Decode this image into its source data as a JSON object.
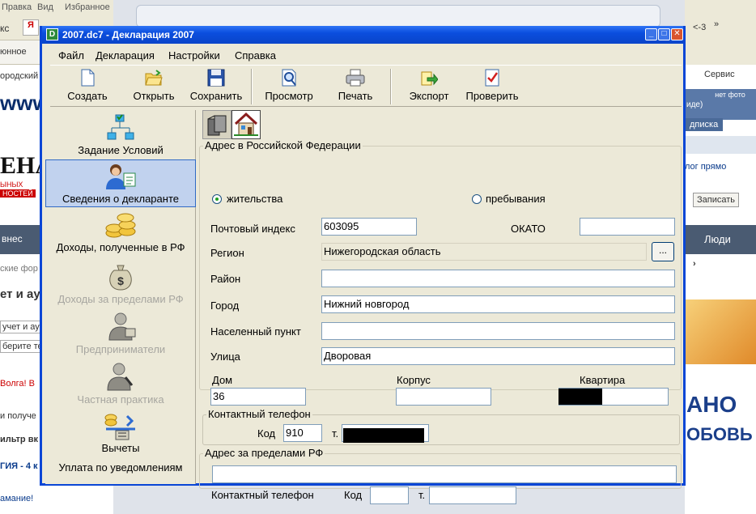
{
  "browser": {
    "menu": [
      "Правка",
      "Вид",
      "Избранное"
    ],
    "address_fragment": "кс",
    "links_fragment": "юнное",
    "left_texts": [
      "ородский",
      "ЕНАР",
      "ЫНЫХ",
      "НОСТЕЙ",
      "внес",
      "ские фор",
      "ет и ау",
      "учет и ау",
      "берите те",
      "Волга! В",
      "и получе",
      "ильтр вк",
      "ГИЯ - 4 к",
      "амание!"
    ],
    "right_texts": [
      "<-3",
      "»",
      "Сервис",
      "дписка",
      "Люди",
      "лог прямо",
      "Записать",
      "АНО",
      "ОБОВЬ",
      "нет фото",
      "иде)"
    ]
  },
  "window": {
    "title": "2007.dc7 - Декларация 2007",
    "menu": [
      "Файл",
      "Декларация",
      "Настройки",
      "Справка"
    ]
  },
  "toolbar": {
    "create": "Создать",
    "open": "Открыть",
    "save": "Сохранить",
    "preview": "Просмотр",
    "print": "Печать",
    "export": "Экспорт",
    "check": "Проверить"
  },
  "sidebar": {
    "items": [
      {
        "label": "Задание Условий",
        "icon": "conditions-icon"
      },
      {
        "label": "Сведения о декларанте",
        "icon": "declarant-icon"
      },
      {
        "label": "Доходы, полученные в РФ",
        "icon": "coins-icon"
      },
      {
        "label": "Доходы за пределами РФ",
        "icon": "money-bag-icon"
      },
      {
        "label": "Предприниматели",
        "icon": "entrepreneur-icon"
      },
      {
        "label": "Частная практика",
        "icon": "private-practice-icon"
      },
      {
        "label": "Вычеты",
        "icon": "deductions-icon"
      },
      {
        "label": "Уплата по уведомлениям",
        "icon": ""
      }
    ]
  },
  "address_rf": {
    "title": "Адрес в Российской Федерации",
    "residence_label": "жительства",
    "stay_label": "пребывания",
    "selected": "жительства",
    "postal_label": "Почтовый индекс",
    "postal_value": "603095",
    "okato_label": "ОКАТО",
    "okato_value": "",
    "region_label": "Регион",
    "region_value": "Нижегородская область",
    "browse_button": "...",
    "district_label": "Район",
    "district_value": "",
    "city_label": "Город",
    "city_value": "Нижний новгород",
    "settlement_label": "Населенный пункт",
    "settlement_value": "",
    "street_label": "Улица",
    "street_value": "Дворовая",
    "house_label": "Дом",
    "house_value": "36",
    "building_label": "Корпус",
    "building_value": "",
    "apartment_label": "Квартира",
    "phone_group": "Контактный телефон",
    "code_label": "Код",
    "code_value": "910",
    "tel_label": "т."
  },
  "address_abroad": {
    "title": "Адрес за пределами РФ",
    "address_value": "",
    "phone_label": "Контактный телефон",
    "code_label": "Код",
    "code_value": "",
    "tel_label": "т.",
    "tel_value": ""
  }
}
